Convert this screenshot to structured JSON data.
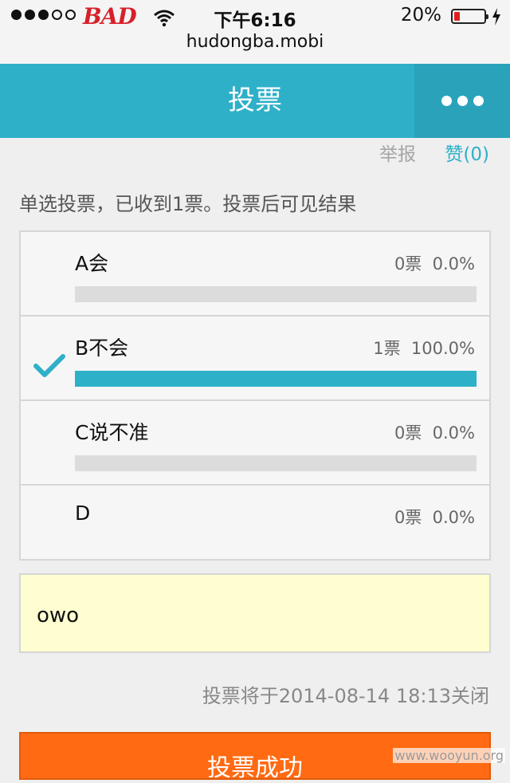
{
  "status_bar": {
    "carrier": "BAD",
    "time": "下午6:16",
    "battery_pct": "20%",
    "battery_level": 0.2,
    "url": "hudongba.mobi"
  },
  "header": {
    "title": "投票",
    "more_icon": "ellipsis-icon"
  },
  "actions": {
    "report": "举报",
    "like": "赞(0)"
  },
  "poll": {
    "description": "单选投票，已收到1票。投票后可见结果",
    "options": [
      {
        "label": "A会",
        "stat": "0票  0.0%",
        "percent": 0.0,
        "selected": false
      },
      {
        "label": "B不会",
        "stat": "1票  100.0%",
        "percent": 100.0,
        "selected": true
      },
      {
        "label": "C说不准",
        "stat": "0票  0.0%",
        "percent": 0.0,
        "selected": false
      },
      {
        "label": "D",
        "stat": "0票  0.0%",
        "percent": 0.0,
        "selected": false
      }
    ],
    "accent": "#2eb0c8"
  },
  "comment": {
    "text": "owo"
  },
  "closing_text": "投票将于2014-08-14 18:13关闭",
  "submit_label": "投票成功",
  "watermark": "www.wooyun.org"
}
